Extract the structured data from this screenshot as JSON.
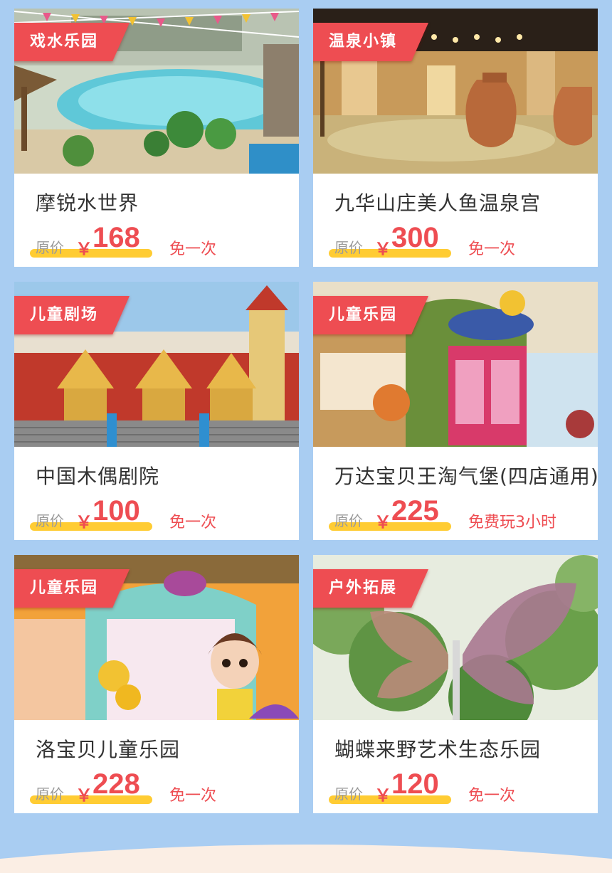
{
  "cards": [
    {
      "tag": "戏水乐园",
      "name": "摩锐水世界",
      "orig_label": "原价",
      "currency": "￥",
      "price": "168",
      "offer": "免一次",
      "scene": "water-park"
    },
    {
      "tag": "温泉小镇",
      "name": "九华山庄美人鱼温泉宫",
      "orig_label": "原价",
      "currency": "￥",
      "price": "300",
      "offer": "免一次",
      "scene": "hot-spring"
    },
    {
      "tag": "儿童剧场",
      "name": "中国木偶剧院",
      "orig_label": "原价",
      "currency": "￥",
      "price": "100",
      "offer": "免一次",
      "scene": "puppet-theater"
    },
    {
      "tag": "儿童乐园",
      "name": "万达宝贝王淘气堡(四店通用)",
      "orig_label": "原价",
      "currency": "￥",
      "price": "225",
      "offer": "免费玩3小时",
      "scene": "kids-playground"
    },
    {
      "tag": "儿童乐园",
      "name": "洛宝贝儿童乐园",
      "orig_label": "原价",
      "currency": "￥",
      "price": "228",
      "offer": "免一次",
      "scene": "cartoon-park"
    },
    {
      "tag": "户外拓展",
      "name": "蝴蝶来野艺术生态乐园",
      "orig_label": "原价",
      "currency": "￥",
      "price": "120",
      "offer": "免一次",
      "scene": "butterfly-sculpture"
    }
  ],
  "colors": {
    "background": "#a9cdf2",
    "accent_red": "#ee4d52",
    "highlight_yellow": "#ffcc33",
    "text_dark": "#333333",
    "text_gray": "#9a9a9a"
  }
}
